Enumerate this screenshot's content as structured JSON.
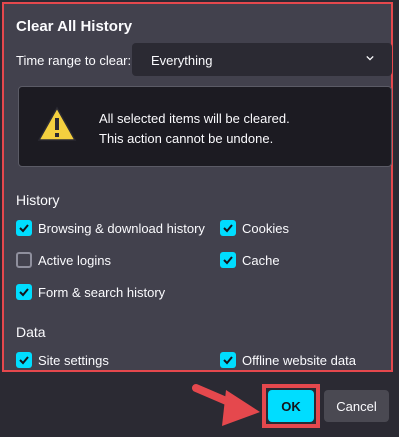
{
  "dialog": {
    "title": "Clear All History",
    "time_range": {
      "label": "Time range to clear:",
      "selected": "Everything"
    },
    "warning": {
      "line1": "All selected items will be cleared.",
      "line2": "This action cannot be undone."
    },
    "history": {
      "heading": "History",
      "items": [
        {
          "label": "Browsing & download history",
          "checked": true
        },
        {
          "label": "Cookies",
          "checked": true
        },
        {
          "label": "Active logins",
          "checked": false
        },
        {
          "label": "Cache",
          "checked": true
        },
        {
          "label": "Form & search history",
          "checked": true
        }
      ]
    },
    "data": {
      "heading": "Data",
      "items": [
        {
          "label": "Site settings",
          "checked": true
        },
        {
          "label": "Offline website data",
          "checked": true
        }
      ]
    }
  },
  "buttons": {
    "ok": "OK",
    "cancel": "Cancel"
  },
  "colors": {
    "accent": "#00ddff",
    "highlight": "#e5484d",
    "dialog_bg": "#42414d",
    "warning_icon": "#f4d03f"
  }
}
